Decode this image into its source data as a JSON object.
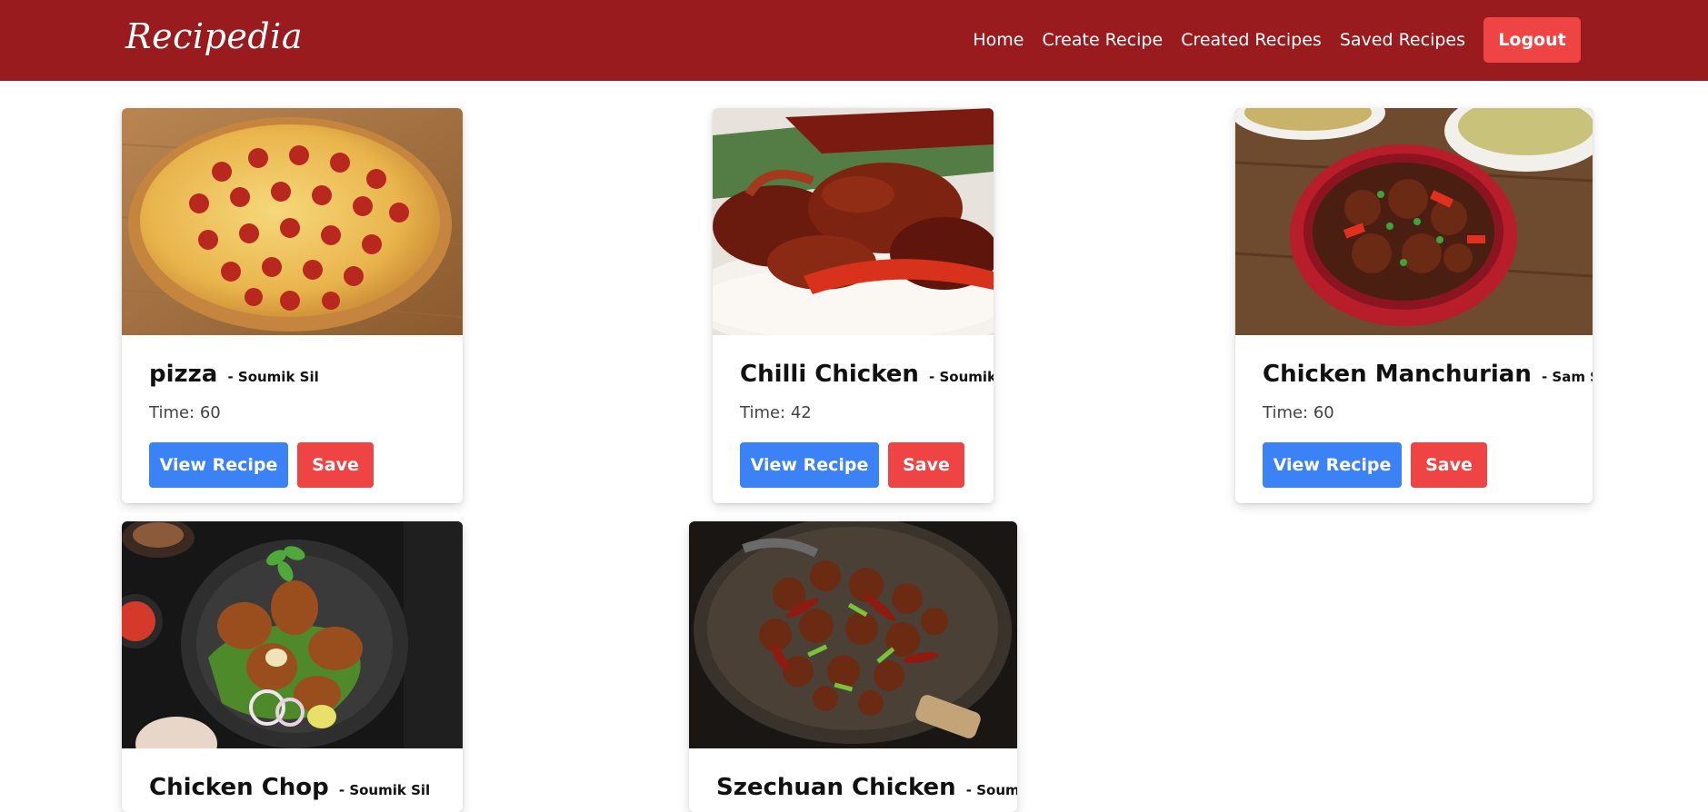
{
  "nav": {
    "brand": "Recipedia",
    "links": [
      "Home",
      "Create Recipe",
      "Created Recipes",
      "Saved Recipes"
    ],
    "logout_label": "Logout"
  },
  "colors": {
    "navbar": "#991b1e",
    "view_button": "#3b82f6",
    "save_button": "#ef4444",
    "logout_button": "#ef4444"
  },
  "recipes": [
    {
      "name": "pizza",
      "author": "- Soumik Sil",
      "time": "Time: 60",
      "view_label": "View Recipe",
      "save_label": "Save",
      "image": "pepperoni-pizza-photo"
    },
    {
      "name": "Chilli Chicken",
      "author": "- Soumik Sil",
      "time": "Time: 42",
      "view_label": "View Recipe",
      "save_label": "Save",
      "image": "chilli-chicken-photo"
    },
    {
      "name": "Chicken Manchurian",
      "author": "- Sam Storm",
      "time": "Time: 60",
      "view_label": "View Recipe",
      "save_label": "Save",
      "image": "chicken-manchurian-photo"
    },
    {
      "name": "Chicken Chop",
      "author": "- Soumik Sil",
      "image": "chicken-chop-photo"
    },
    {
      "name": "Szechuan Chicken",
      "author": "- Soumik Sil",
      "image": "szechuan-chicken-photo"
    }
  ]
}
